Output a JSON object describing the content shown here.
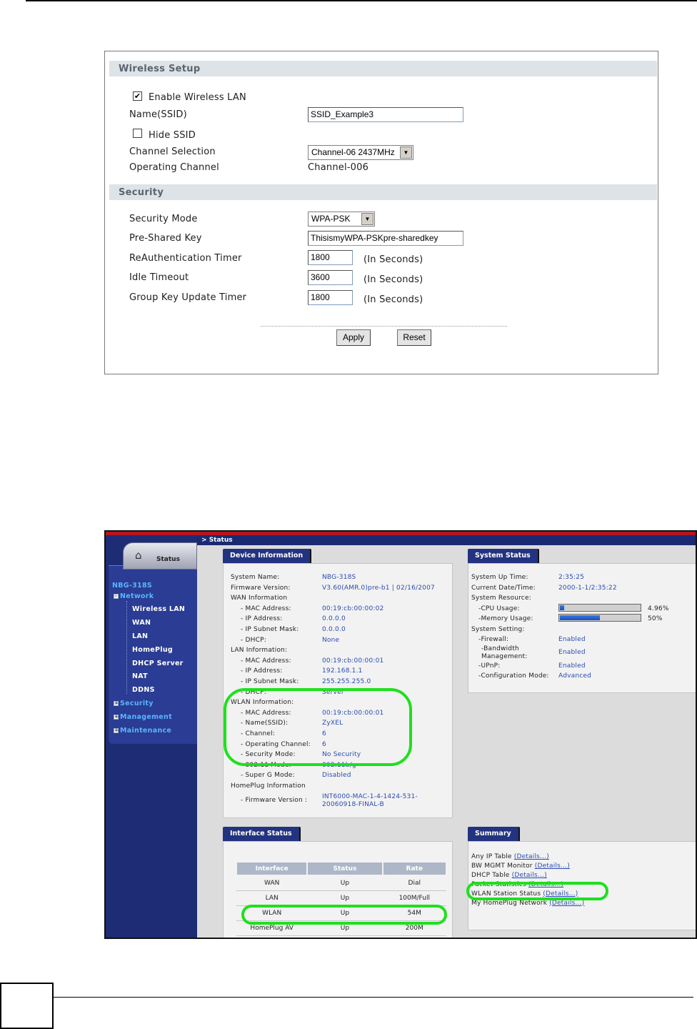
{
  "wireless_setup": {
    "heading": "Wireless Setup",
    "enable_wireless_label": "Enable Wireless LAN",
    "enable_wireless_checked": true,
    "ssid_label": "Name(SSID)",
    "ssid_value": "SSID_Example3",
    "hide_ssid_label": "Hide SSID",
    "hide_ssid_checked": false,
    "channel_selection_label": "Channel Selection",
    "channel_selection_value": "Channel-06 2437MHz",
    "operating_channel_label": "Operating Channel",
    "operating_channel_value": "Channel-006"
  },
  "security": {
    "heading": "Security",
    "mode_label": "Security Mode",
    "mode_value": "WPA-PSK",
    "psk_label": "Pre-Shared Key",
    "psk_value": "ThisismyWPA-PSKpre-sharedkey",
    "reauth_label": "ReAuthentication Timer",
    "reauth_value": "1800",
    "idle_label": "Idle Timeout",
    "idle_value": "3600",
    "gkut_label": "Group Key Update Timer",
    "gkut_value": "1800",
    "unit": "(In Seconds)"
  },
  "buttons": {
    "apply": "Apply",
    "reset": "Reset"
  },
  "status_page": {
    "breadcrumb": "Status",
    "tab_label": "Status",
    "sidebar": {
      "model": "NBG-318S",
      "network": "Network",
      "items": [
        "Wireless LAN",
        "WAN",
        "LAN",
        "HomePlug",
        "DHCP Server",
        "NAT",
        "DDNS"
      ],
      "security": "Security",
      "management": "Management",
      "maintenance": "Maintenance"
    },
    "device_info": {
      "title": "Device Information",
      "rows": [
        {
          "k": "System Name:",
          "v": "NBG-318S"
        },
        {
          "k": "Firmware Version:",
          "v": "V3.60(AMR.0)pre-b1 | 02/16/2007"
        },
        {
          "k": "WAN Information",
          "v": ""
        },
        {
          "k": "- MAC Address:",
          "v": "00:19:cb:00:00:02"
        },
        {
          "k": "- IP Address:",
          "v": "0.0.0.0"
        },
        {
          "k": "- IP Subnet Mask:",
          "v": "0.0.0.0"
        },
        {
          "k": "- DHCP:",
          "v": "None"
        },
        {
          "k": "LAN Information:",
          "v": ""
        },
        {
          "k": "- MAC Address:",
          "v": "00:19:cb:00:00:01"
        },
        {
          "k": "- IP Address:",
          "v": "192.168.1.1"
        },
        {
          "k": "- IP Subnet Mask:",
          "v": "255.255.255.0"
        },
        {
          "k": "- DHCP:",
          "v": "Server"
        },
        {
          "k": "WLAN Information:",
          "v": ""
        },
        {
          "k": "- MAC Address:",
          "v": "00:19:cb:00:00:01"
        },
        {
          "k": "- Name(SSID):",
          "v": "ZyXEL"
        },
        {
          "k": "- Channel:",
          "v": "6"
        },
        {
          "k": "- Operating Channel:",
          "v": "6"
        },
        {
          "k": "- Security Mode:",
          "v": "No Security"
        },
        {
          "k": "- 802.11 Mode:",
          "v": "802.11b/g"
        },
        {
          "k": "- Super G Mode:",
          "v": "Disabled"
        },
        {
          "k": "HomePlug Information",
          "v": ""
        }
      ],
      "fw_label": "- Firmware Version :",
      "fw_value_1": "INT6000-MAC-1-4-1424-531-",
      "fw_value_2": "20060918-FINAL-B"
    },
    "system_status": {
      "title": "System Status",
      "up_time_label": "System Up Time:",
      "up_time": "2:35:25",
      "datetime_label": "Current Date/Time:",
      "datetime": "2000-1-1/2:35:22",
      "resource_label": "System Resource:",
      "cpu_label": "-CPU Usage:",
      "cpu_value": "4.96%",
      "cpu_fraction": 0.0496,
      "mem_label": "-Memory Usage:",
      "mem_value": "50%",
      "mem_fraction": 0.5,
      "setting_label": "System Setting:",
      "firewall_label": "-Firewall:",
      "firewall": "Enabled",
      "bw_label_1": "-Bandwidth",
      "bw_label_2": "Management:",
      "bw": "Enabled",
      "upnp_label": "-UPnP:",
      "upnp": "Enabled",
      "config_label": "-Configuration Mode:",
      "config": "Advanced"
    },
    "interface_status": {
      "title": "Interface Status",
      "headers": [
        "Interface",
        "Status",
        "Rate"
      ],
      "rows": [
        [
          "WAN",
          "Up",
          "Dial"
        ],
        [
          "LAN",
          "Up",
          "100M/Full"
        ],
        [
          "WLAN",
          "Up",
          "54M"
        ],
        [
          "HomePlug AV",
          "Up",
          "200M"
        ]
      ]
    },
    "summary": {
      "title": "Summary",
      "rows": [
        {
          "k": "Any IP Table",
          "link": "(Details...)"
        },
        {
          "k": "BW MGMT Monitor",
          "link": "(Details...)"
        },
        {
          "k": "DHCP Table",
          "link": "(Details...)"
        },
        {
          "k": "Packet Statistics",
          "link": "(Details...)"
        },
        {
          "k": "WLAN Station Status",
          "link": "(Details...)"
        },
        {
          "k": "My HomePlug Network",
          "link": "(Details...)"
        }
      ]
    }
  },
  "colors": {
    "highlight": "#1ee01e",
    "nav_blue": "#1f2f7a",
    "link": "#2a4bb0"
  }
}
